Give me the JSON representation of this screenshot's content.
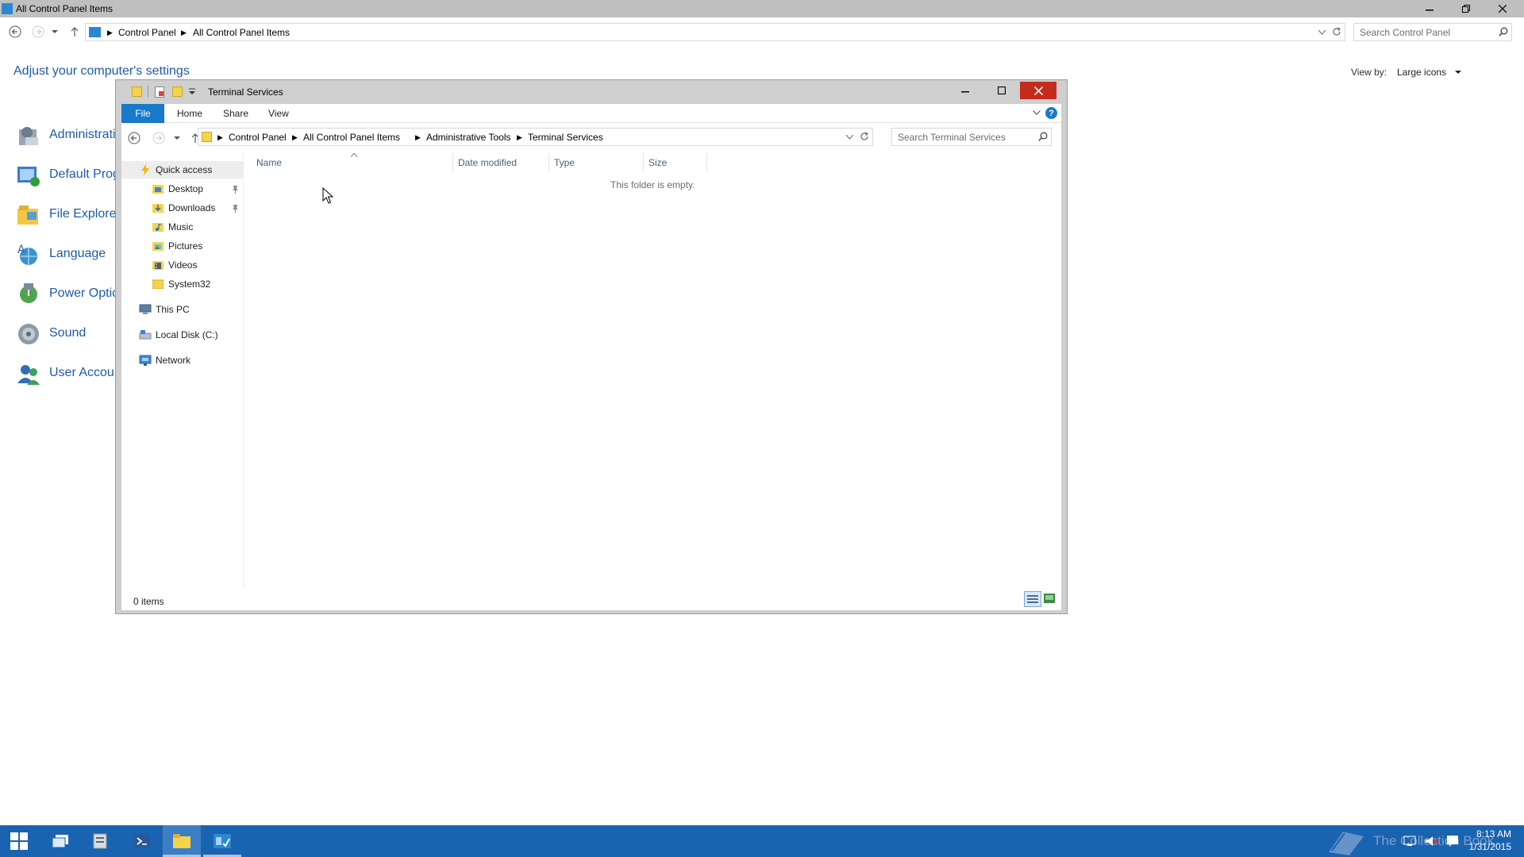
{
  "control_panel": {
    "window_title": "All Control Panel Items",
    "breadcrumb": [
      "Control Panel",
      "All Control Panel Items"
    ],
    "search_placeholder": "Search Control Panel",
    "heading": "Adjust your computer's settings",
    "view_by_label": "View by:",
    "view_by_value": "Large icons",
    "items": [
      {
        "label": "Administrati",
        "icon": "admin-tools-icon"
      },
      {
        "label": "Default Prog",
        "icon": "default-programs-icon"
      },
      {
        "label": "File Explorer",
        "icon": "file-explorer-options-icon"
      },
      {
        "label": "Language",
        "icon": "language-icon"
      },
      {
        "label": "Power Optic",
        "icon": "power-options-icon"
      },
      {
        "label": "Sound",
        "icon": "sound-icon"
      },
      {
        "label": "User Accour",
        "icon": "user-accounts-icon"
      }
    ]
  },
  "explorer": {
    "window_title": "Terminal Services",
    "ribbon_tabs": [
      "File",
      "Home",
      "Share",
      "View"
    ],
    "breadcrumb": [
      "Control Panel",
      "All Control Panel Items",
      "Administrative Tools",
      "Terminal Services"
    ],
    "search_placeholder": "Search Terminal Services",
    "nav_pane": {
      "quick_access": "Quick access",
      "quick_items": [
        {
          "label": "Desktop",
          "pinned": true
        },
        {
          "label": "Downloads",
          "pinned": true
        },
        {
          "label": "Music",
          "pinned": false
        },
        {
          "label": "Pictures",
          "pinned": false
        },
        {
          "label": "Videos",
          "pinned": false
        },
        {
          "label": "System32",
          "pinned": false
        }
      ],
      "this_pc": "This PC",
      "local_disk": "Local Disk (C:)",
      "network": "Network"
    },
    "columns": [
      "Name",
      "Date modified",
      "Type",
      "Size"
    ],
    "empty_message": "This folder is empty.",
    "status": "0 items"
  },
  "taskbar": {
    "watermark": "The Collection Book",
    "time": "8:13 AM",
    "date": "1/31/2015"
  },
  "colors": {
    "accent": "#1979ca",
    "taskbar": "#1a63b0",
    "link": "#1e5aa8",
    "close": "#c42b1c"
  }
}
